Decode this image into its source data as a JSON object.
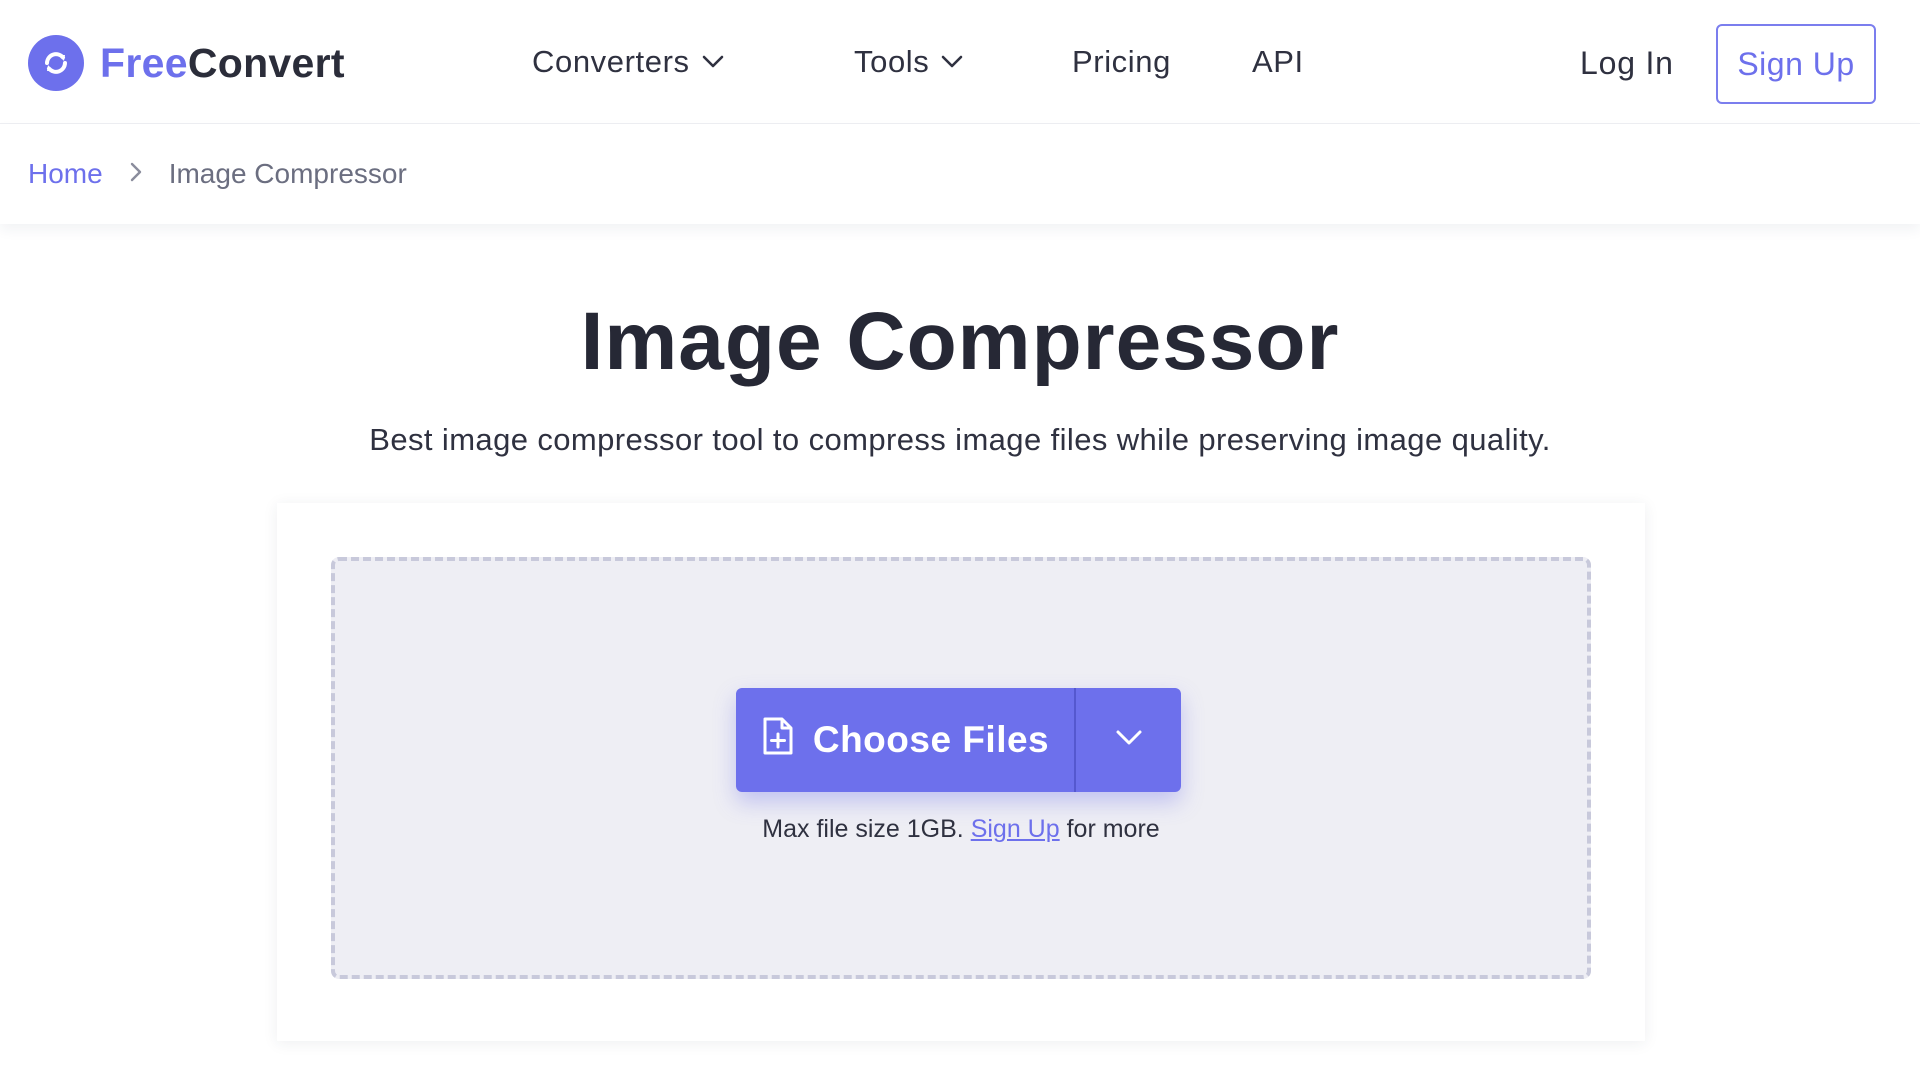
{
  "brand": {
    "name_part1": "Free",
    "name_part2": "Convert",
    "accent_color": "#6d70ec",
    "logo_icon": "refresh-cycle-icon"
  },
  "nav": {
    "items": [
      {
        "label": "Converters",
        "has_dropdown": true
      },
      {
        "label": "Tools",
        "has_dropdown": true
      },
      {
        "label": "Pricing",
        "has_dropdown": false
      },
      {
        "label": "API",
        "has_dropdown": false
      }
    ],
    "login_label": "Log In",
    "signup_label": "Sign Up"
  },
  "breadcrumb": {
    "home": "Home",
    "separator_icon": "chevron-right-icon",
    "current": "Image Compressor"
  },
  "hero": {
    "title": "Image Compressor",
    "subtitle": "Best image compressor tool to compress image files while preserving image quality."
  },
  "upload": {
    "choose_label": "Choose Files",
    "choose_icon": "file-add-icon",
    "dropdown_icon": "chevron-down-icon",
    "note_prefix": "Max file size 1GB.",
    "note_link": "Sign Up",
    "note_suffix": "for more"
  }
}
